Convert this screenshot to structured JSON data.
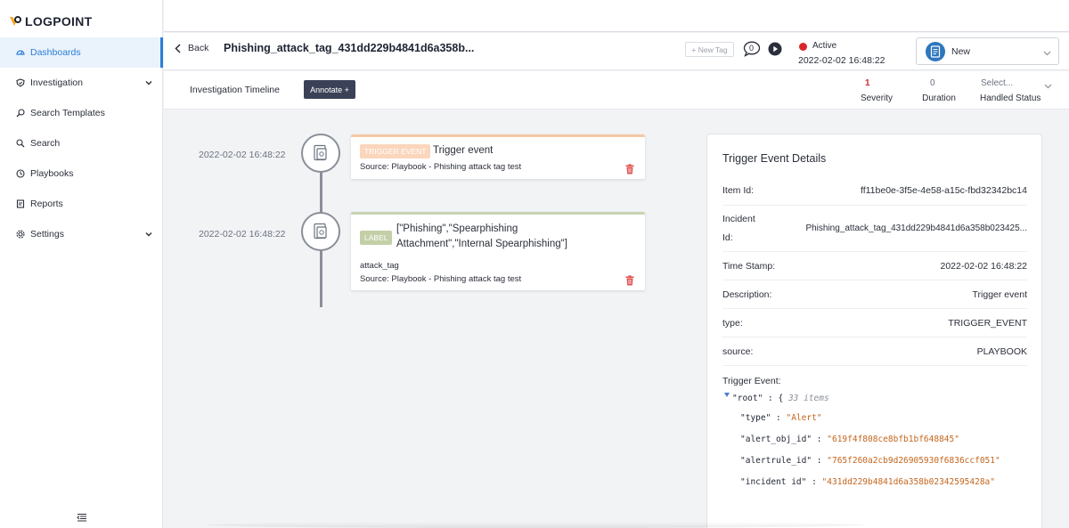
{
  "logo": {
    "text": "LOGPOINT"
  },
  "sidebar": {
    "items": [
      {
        "label": "Dashboards",
        "icon": "dashboard-icon",
        "active": true
      },
      {
        "label": "Investigation",
        "icon": "shield-icon",
        "expandable": true
      },
      {
        "label": "Search Templates",
        "icon": "search-template-icon"
      },
      {
        "label": "Search",
        "icon": "search-icon"
      },
      {
        "label": "Playbooks",
        "icon": "playbook-icon"
      },
      {
        "label": "Reports",
        "icon": "report-icon"
      },
      {
        "label": "Settings",
        "icon": "gear-icon",
        "expandable": true
      }
    ]
  },
  "header": {
    "back_label": "Back",
    "title": "Phishing_attack_tag_431dd229b4841d6a358b...",
    "new_tag_label": "+ New Tag",
    "comment_count": "0",
    "status": "Active",
    "status_time": "2022-02-02 16:48:22",
    "state_value": "New"
  },
  "subheader": {
    "title": "Investigation Timeline",
    "annotate_label": "Annotate +",
    "severity_value": "1",
    "severity_label": "Severity",
    "duration_value": "0",
    "duration_label": "Duration",
    "handled_placeholder": "Select...",
    "handled_label": "Handled Status"
  },
  "timeline": [
    {
      "time": "2022-02-02 16:48:22",
      "badge": "TRIGGER EVENT",
      "title": "Trigger event",
      "source": "Source: Playbook - Phishing attack tag test"
    },
    {
      "time": "2022-02-02 16:48:22",
      "badge": "LABEL",
      "title_line1": "[\"Phishing\",\"Spearphishing",
      "title_line2": "Attachment\",\"Internal Spearphishing\"]",
      "subtitle": "attack_tag",
      "source": "Source: Playbook - Phishing attack tag test"
    }
  ],
  "details": {
    "title": "Trigger Event Details",
    "rows": [
      {
        "key": "Item Id:",
        "value": "ff11be0e-3f5e-4e58-a15c-fbd32342bc14"
      },
      {
        "key_line1": "Incident",
        "key_line2": "Id:",
        "value": "Phishing_attack_tag_431dd229b4841d6a358b023425..."
      },
      {
        "key": "Time Stamp:",
        "value": "2022-02-02 16:48:22"
      },
      {
        "key": "Description:",
        "value": "Trigger event"
      },
      {
        "key": "type:",
        "value": "TRIGGER_EVENT"
      },
      {
        "key": "source:",
        "value": "PLAYBOOK"
      }
    ],
    "trigger_event_label": "Trigger Event:",
    "json": {
      "root_key": "\"root\"",
      "root_open": " : {",
      "root_meta": "33 items",
      "entries": [
        {
          "key": "\"type\"",
          "sep": " : ",
          "value": "\"Alert\""
        },
        {
          "key": "\"alert_obj_id\"",
          "sep": " : ",
          "value": "\"619f4f808ce8bfb1bf648845\""
        },
        {
          "key": "\"alertrule_id\"",
          "sep": " : ",
          "value": "\"765f260a2cb9d26905930f6836ccf051\""
        },
        {
          "key": "\"incident id\"",
          "sep": " : ",
          "value": "\"431dd229b4841d6a358b02342595428a\""
        }
      ]
    }
  },
  "colors": {
    "accent": "#2a7ed8",
    "severity": "#d9262c",
    "trigger_badge": "#fbd6bd",
    "label_badge": "#c3cfa7",
    "json_string": "#c4651c"
  }
}
